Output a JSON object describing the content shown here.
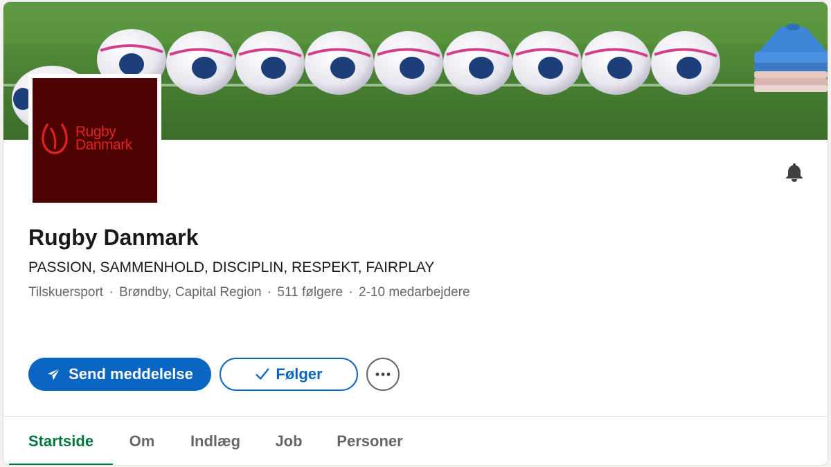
{
  "company": {
    "name": "Rugby Danmark",
    "tagline": "PASSION, SAMMENHOLD, DISCIPLIN, RESPEKT, FAIRPLAY",
    "logo_text_line1": "Rugby",
    "logo_text_line2": "Danmark",
    "industry": "Tilskuersport",
    "location": "Brøndby, Capital Region",
    "followers": "511 følgere",
    "employees": "2-10 medarbejdere",
    "separator": "·"
  },
  "actions": {
    "message_label": "Send meddelelse",
    "follow_label": "Følger"
  },
  "tabs": [
    {
      "label": "Startside",
      "active": true
    },
    {
      "label": "Om",
      "active": false
    },
    {
      "label": "Indlæg",
      "active": false
    },
    {
      "label": "Job",
      "active": false
    },
    {
      "label": "Personer",
      "active": false
    }
  ],
  "colors": {
    "primary": "#0a66c2",
    "active_tab": "#057642",
    "logo_bg": "#4e0303",
    "logo_fg": "#e2241f"
  },
  "icons": {
    "notify": "bell-icon",
    "message": "send-icon",
    "follow": "checkmark-icon",
    "more": "more-icon"
  }
}
